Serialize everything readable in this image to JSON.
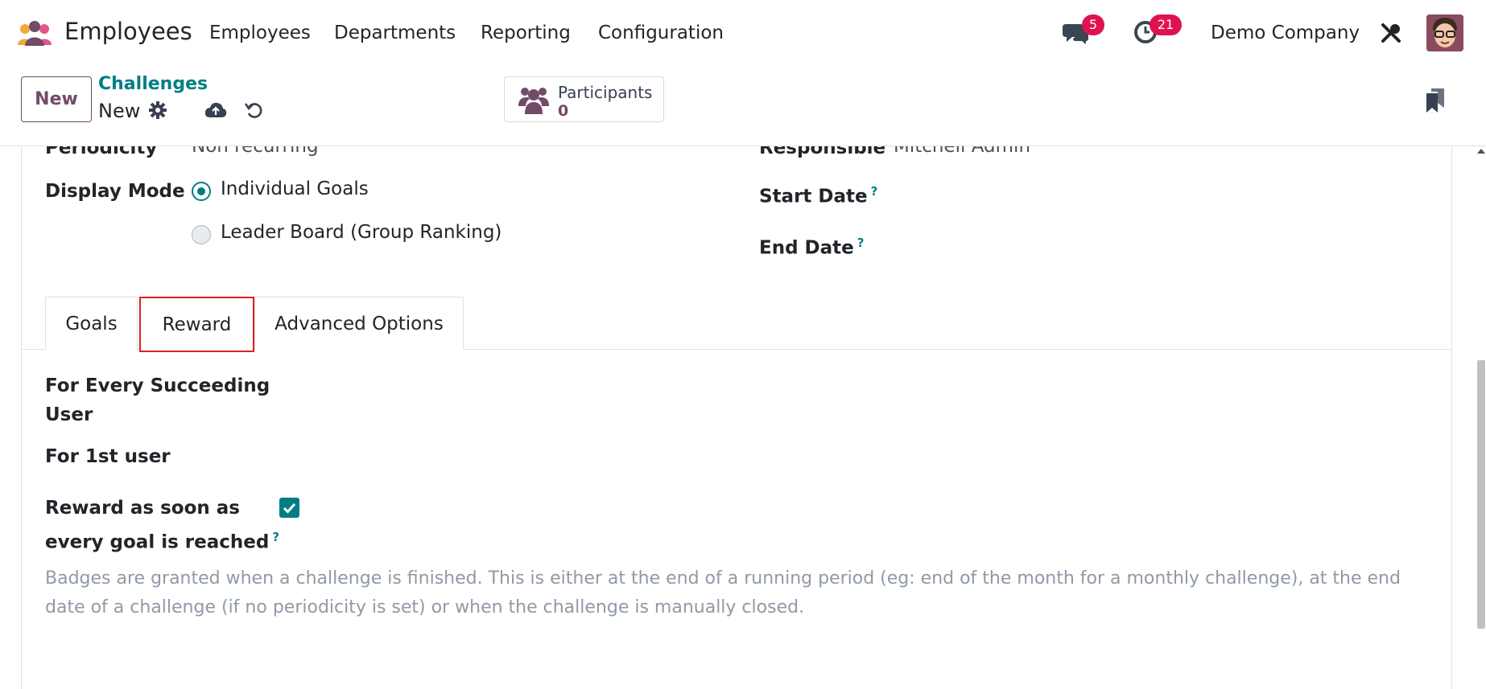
{
  "navbar": {
    "app_name": "Employees",
    "menu": [
      "Employees",
      "Departments",
      "Reporting",
      "Configuration"
    ],
    "messages_badge": "5",
    "activities_badge": "21",
    "company": "Demo Company"
  },
  "control": {
    "new_label": "New",
    "breadcrumb": "Challenges",
    "record_name": "New",
    "participants_label": "Participants",
    "participants_count": "0"
  },
  "form": {
    "periodicity_label": "Periodicity",
    "periodicity_value": "Non recurring",
    "responsible_label": "Responsible",
    "responsible_value": "Mitchell Admin",
    "display_mode_label": "Display Mode",
    "display_mode_options": [
      "Individual Goals",
      "Leader Board (Group Ranking)"
    ],
    "display_mode_selected": "Individual Goals",
    "start_date_label": "Start Date",
    "end_date_label": "End Date",
    "help_mark": "?"
  },
  "tabs": [
    "Goals",
    "Reward",
    "Advanced Options"
  ],
  "active_tab": "Reward",
  "reward": {
    "succeeding_label": "For Every Succeeding User",
    "succeeding_line1": "For Every Succeeding",
    "succeeding_line2": "User",
    "first_user_label": "For 1st user",
    "reward_asap_line1": "Reward as soon as",
    "reward_asap_line2": "every goal is reached",
    "reward_asap_checked": true,
    "note": "Badges are granted when a challenge is finished. This is either at the end of a running period (eg: end of the month for a monthly challenge), at the end date of a challenge (if no periodicity is set) or when the challenge is manually closed."
  },
  "colors": {
    "brand": "#714b67",
    "accent": "#017e84",
    "badge": "#e0114f",
    "highlight": "#e02020"
  }
}
